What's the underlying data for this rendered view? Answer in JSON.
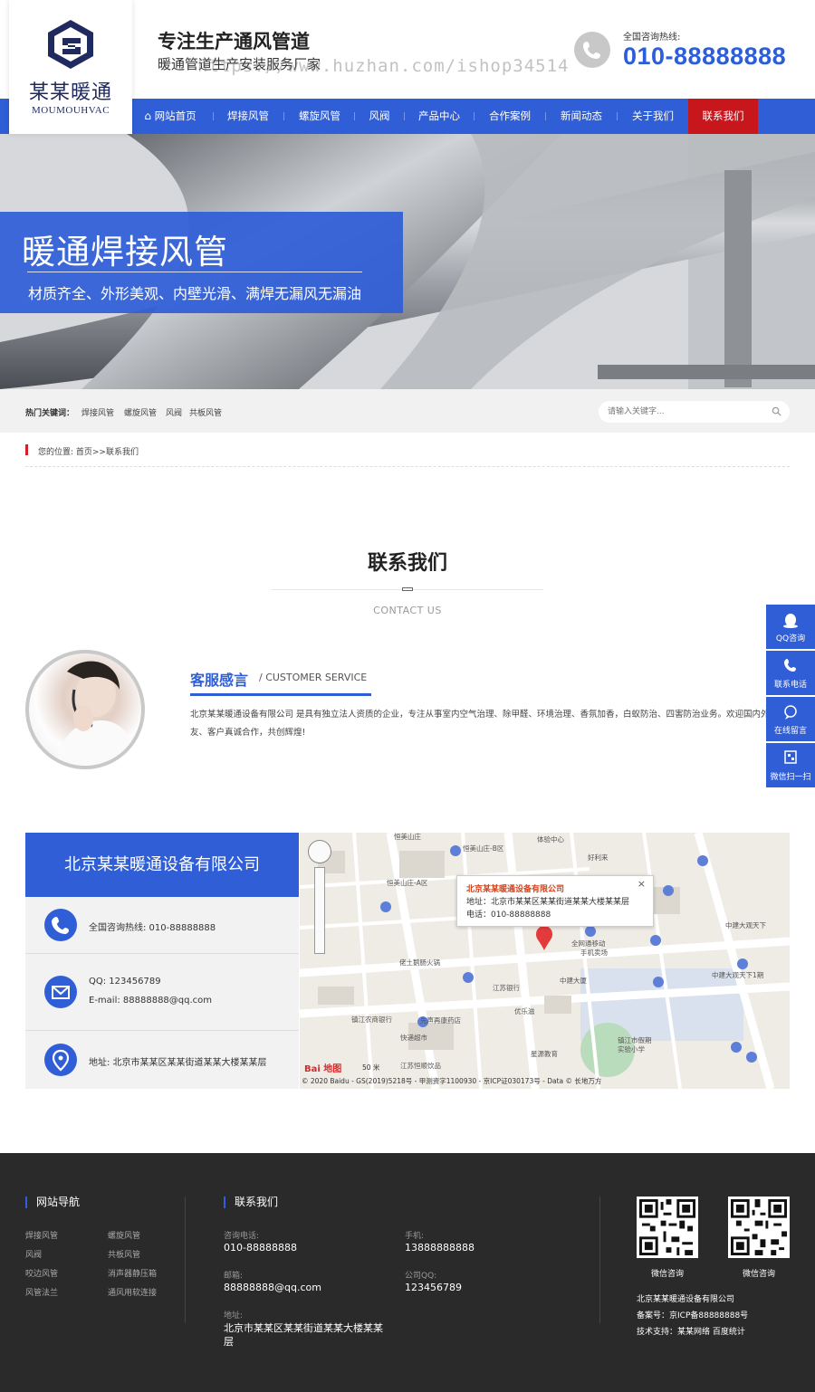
{
  "header": {
    "logo_cn": "某某暖通",
    "logo_en": "MOUMOUHVAC",
    "slogan_main": "专注生产通风管道",
    "slogan_sub": "暖通管道生产安装服务厂家",
    "watermark": "https://www.huzhan.com/ishop34514",
    "hotline_label": "全国咨询热线:",
    "hotline": "010-88888888"
  },
  "nav": {
    "items": [
      "网站首页",
      "焊接风管",
      "螺旋风管",
      "风阀",
      "产品中心",
      "合作案例",
      "新闻动态",
      "关于我们",
      "联系我们"
    ],
    "active_index": 8,
    "active_color": "#c8161d"
  },
  "banner": {
    "title": "暖通焊接风管",
    "subtitle": "材质齐全、外形美观、内壁光滑、满焊无漏风无漏油"
  },
  "keywords": {
    "label": "热门关键词：",
    "items": [
      "焊接风管",
      "螺旋风管",
      "风阀",
      "共板风管"
    ],
    "search_placeholder": "请输入关键字..."
  },
  "breadcrumb": {
    "text": "您的位置:   首页>>联系我们"
  },
  "section": {
    "title": "联系我们",
    "subtitle_en": "CONTACT US"
  },
  "service": {
    "title": "客服感言",
    "title_en": "/ CUSTOMER SERVICE",
    "text": "北京某某暖通设备有限公司 是具有独立法人资质的企业，专注从事室内空气治理、除甲醛、环境治理、香氛加香，白蚁防治、四害防治业务。欢迎国内外朋友、客户真诚合作，共创辉煌!"
  },
  "contact": {
    "company": "北京某某暖通设备有限公司",
    "hotline": "全国咨询热线:  010-88888888",
    "qq": "QQ:  123456789",
    "email": "E-mail:  88888888@qq.com",
    "address": "地址:  北京市某某区某某街道某某大楼某某层"
  },
  "map": {
    "popup_title": "北京某某暖通设备有限公司",
    "popup_address": "地址：北京市某某区某某街道某某大楼某某层",
    "popup_tel": "电话：010-88888888",
    "popup_close": "×",
    "labels": [
      "恒美山庄",
      "恒美山庄-B区",
      "体验中心",
      "好利来",
      "恒美山庄-A区",
      "佬土鹅肠火锅",
      "全网通移动手机卖场",
      "中建大厦",
      "中建大观天下",
      "中建大观天下1期",
      "江苏银行",
      "镇江农商银行",
      "先声再康药店",
      "优乐滋",
      "快递超市",
      "星源教育",
      "镇江市假期实验小学",
      "江苏恒顺饮品"
    ],
    "scale": "50 米",
    "copyright": "© 2020 Baidu - GS(2019)5218号 - 甲测资字1100930 - 京ICP证030173号 - Data © 长地万方",
    "brand": "Bai 地图"
  },
  "sidebar": {
    "items": [
      "QQ咨询",
      "联系电话",
      "在线留言",
      "微信扫一扫"
    ]
  },
  "footer": {
    "nav_title": "网站导航",
    "nav_links": [
      "焊接风管",
      "螺旋风管",
      "风阀",
      "共板风管",
      "咬边风管",
      "消声器静压箱",
      "风管法兰",
      "通风用软连接"
    ],
    "contact_title": "联系我们",
    "phone_label": "咨询电话:",
    "phone": "010-88888888",
    "mobile_label": "手机:",
    "mobile": "13888888888",
    "email_label": "邮箱:",
    "email": "88888888@qq.com",
    "qq_label": "公司QQ:",
    "qq": "123456789",
    "address_label": "地址:",
    "address": "北京市某某区某某街道某某大楼某某层",
    "qr_captions": [
      "微信咨询",
      "微信咨询"
    ],
    "company": "北京某某暖通设备有限公司",
    "icp": "备案号：京ICP备88888888号",
    "support": "技术支持：某某网络   百度统计"
  }
}
